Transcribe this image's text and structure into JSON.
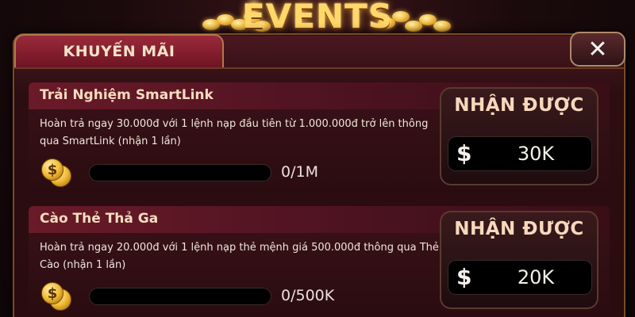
{
  "header": {
    "title": "EVENTS"
  },
  "panel": {
    "tab_label": "KHUYẾN MÃI",
    "close_label": "✕"
  },
  "events": [
    {
      "title": "Trải Nghiệm SmartLink",
      "description": "Hoàn trả ngay 30.000đ với 1 lệnh nạp đầu tiên từ 1.000.000đ trở lên thông qua SmartLink (nhận 1 lần)",
      "coin_symbol": "$",
      "progress_current": 0,
      "progress_text": "0/1M",
      "reward_label": "NHẬN ĐƯỢC",
      "reward_currency": "$",
      "reward_amount": "30K"
    },
    {
      "title": "Cào Thẻ Thả Ga",
      "description": "Hoàn trả ngay 20.000đ với 1 lệnh nạp thẻ mệnh giá 500.000đ thông qua Thẻ Cào (nhận 1 lần)",
      "coin_symbol": "$",
      "progress_current": 0,
      "progress_text": "0/500K",
      "reward_label": "NHẬN ĐƯỢC",
      "reward_currency": "$",
      "reward_amount": "20K"
    }
  ],
  "colors": {
    "panel_bg": "#2a0c10",
    "gold": "#ffd76a",
    "tab_red": "#9a2a3a"
  }
}
